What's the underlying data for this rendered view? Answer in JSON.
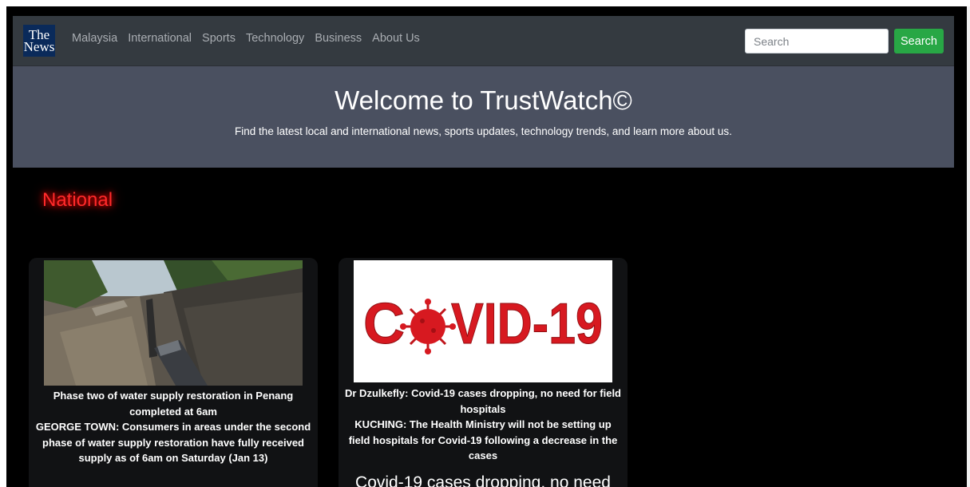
{
  "navbar": {
    "logo_line1": "The",
    "logo_line2": "News",
    "links": [
      "Malaysia",
      "International",
      "Sports",
      "Technology",
      "Business",
      "About Us"
    ],
    "search_placeholder": "Search",
    "search_button": "Search"
  },
  "hero": {
    "title": "Welcome to TrustWatch©",
    "subtitle": "Find the latest local and international news, sports updates, technology trends, and learn more about us."
  },
  "section": {
    "title": "National"
  },
  "cards": [
    {
      "headline": "Phase two of water supply restoration in Penang completed at 6am",
      "summary": "GEORGE TOWN: Consumers in areas under the second phase of water supply restoration have fully received supply as of 6am on Saturday (Jan 13)"
    },
    {
      "image_text_1": "C",
      "image_text_2": "VID-19",
      "headline": "Dr Dzulkefly: Covid-19 cases dropping, no need for field hospitals",
      "summary": "KUCHING: The Health Ministry will not be setting up field hospitals for Covid-19 following a decrease in the cases",
      "extra": "Covid-19 cases dropping, no need"
    }
  ],
  "colors": {
    "navbar_bg": "#343a40",
    "hero_bg": "#4a5060",
    "search_button": "#28a745",
    "section_title": "#ff2a2a"
  }
}
